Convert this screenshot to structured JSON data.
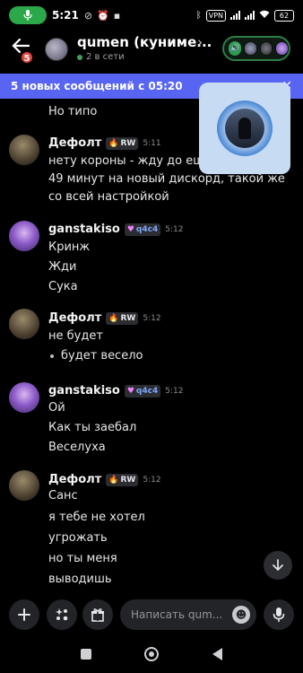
{
  "status_bar": {
    "time": "5:21",
    "vpn": "VPN",
    "battery": "62",
    "icons": [
      "call-active-icon",
      "do-not-disturb-icon",
      "alarm-icon",
      "notification-icon",
      "bluetooth-icon",
      "signal-icon",
      "wifi-icon",
      "battery-icon"
    ]
  },
  "header": {
    "title": "qumen (куниме...",
    "subtitle": "2 в сети",
    "back_badge": "5",
    "colors": {
      "voice_border": "#2d7d46",
      "online": "#3ba55d"
    }
  },
  "new_messages_bar": {
    "text": "5 новых сообщений с 05:20",
    "color": "#5865f2"
  },
  "messages": [
    {
      "type": "continuation",
      "lines": [
        "Но типо"
      ]
    },
    {
      "author": "Дефолт",
      "tag": "RW",
      "tag_icon": "flame-icon",
      "time": "5:11",
      "avatar": "avatar-deffolt",
      "lines": [
        "нету короны - жду до еще р",
        "49 минут на новый дискорд, такой же",
        "со всей настройкой"
      ]
    },
    {
      "author": "ganstakiso",
      "tag": "q4c4",
      "tag_icon": "heart-icon",
      "time": "5:12",
      "avatar": "avatar-ganstakiso",
      "lines": [
        "Кринж",
        "Жди",
        "Сука"
      ]
    },
    {
      "author": "Дефолт",
      "tag": "RW",
      "tag_icon": "flame-icon",
      "time": "5:12",
      "avatar": "avatar-deffolt",
      "lines": [
        "не будет"
      ],
      "bullet": "будет весело"
    },
    {
      "author": "ganstakiso",
      "tag": "q4c4",
      "tag_icon": "heart-icon",
      "time": "5:12",
      "avatar": "avatar-ganstakiso",
      "lines": [
        "Ой",
        "Как ты заебал",
        "Веселуха"
      ]
    },
    {
      "author": "Дефолт",
      "tag": "RW",
      "tag_icon": "flame-icon",
      "time": "5:12",
      "avatar": "avatar-deffolt",
      "lines": [
        "Санс",
        "я тебе не хотел",
        "угрожать",
        "но ты меня",
        "выводишь"
      ]
    }
  ],
  "composer": {
    "placeholder": "Написать qum...",
    "buttons": [
      "plus-icon",
      "apps-icon",
      "gift-icon",
      "microphone-icon"
    ]
  },
  "nav": [
    "recent-apps-icon",
    "home-icon",
    "back-icon"
  ]
}
